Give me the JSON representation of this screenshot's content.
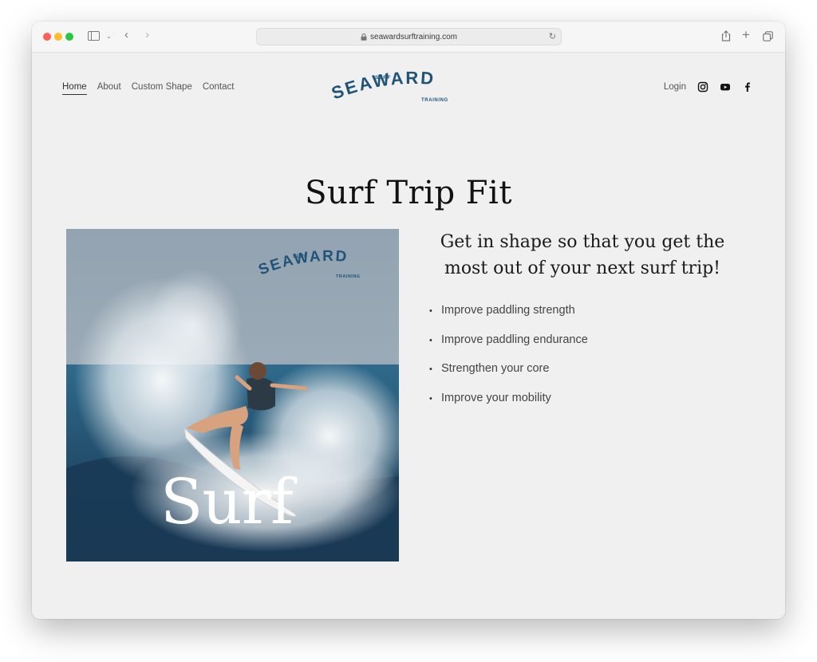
{
  "browser": {
    "url": "seawardsurftraining.com"
  },
  "header": {
    "nav": [
      {
        "label": "Home",
        "active": true
      },
      {
        "label": "About",
        "active": false
      },
      {
        "label": "Custom Shape",
        "active": false
      },
      {
        "label": "Contact",
        "active": false
      }
    ],
    "logo": {
      "top": "SURF",
      "main": "SEAWARD",
      "bottom": "TRAINING",
      "color": "#1f5478"
    },
    "login_label": "Login",
    "social_icons": [
      "instagram-icon",
      "youtube-icon",
      "facebook-icon"
    ]
  },
  "main": {
    "title": "Surf Trip Fit",
    "subtitle": "Get in shape so that you get the most out of your next surf trip!",
    "benefits": [
      "Improve paddling strength",
      "Improve paddling endurance",
      "Strengthen your core",
      "Improve your mobility"
    ],
    "hero": {
      "overlay_text": "Surf",
      "logo_top": "SURF",
      "logo_main": "SEAWARD",
      "logo_bottom": "TRAINING"
    }
  }
}
